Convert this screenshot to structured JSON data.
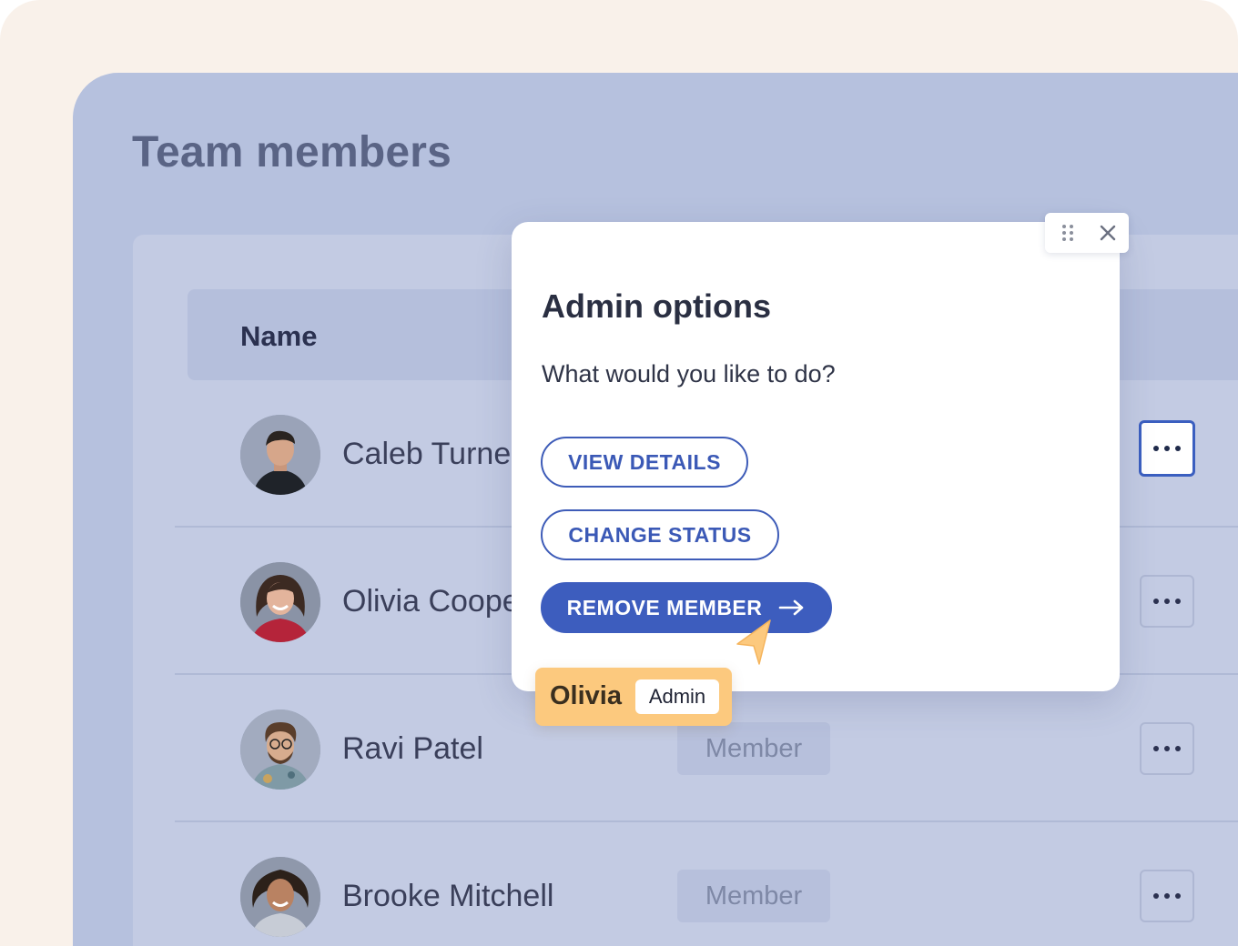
{
  "page": {
    "title": "Team members"
  },
  "table": {
    "columns": {
      "name": "Name"
    },
    "rows": [
      {
        "name": "Caleb Turner",
        "role": ""
      },
      {
        "name": "Olivia Cooper",
        "role": ""
      },
      {
        "name": "Ravi Patel",
        "role": "Member"
      },
      {
        "name": "Brooke Mitchell",
        "role": "Member"
      }
    ]
  },
  "modal": {
    "title": "Admin options",
    "subtitle": "What would you like to do?",
    "actions": {
      "view_details": "VIEW DETAILS",
      "change_status": "CHANGE STATUS",
      "remove_member": "REMOVE MEMBER"
    },
    "icons": [
      "drag-handle-icon",
      "close-icon",
      "arrow-right-icon"
    ]
  },
  "user_tag": {
    "name": "Olivia",
    "role": "Admin"
  },
  "colors": {
    "primary": "#3d5dbe",
    "backdrop": "#b6c1de",
    "highlight": "#fcc97e",
    "page_bg": "#f9f1ea"
  }
}
